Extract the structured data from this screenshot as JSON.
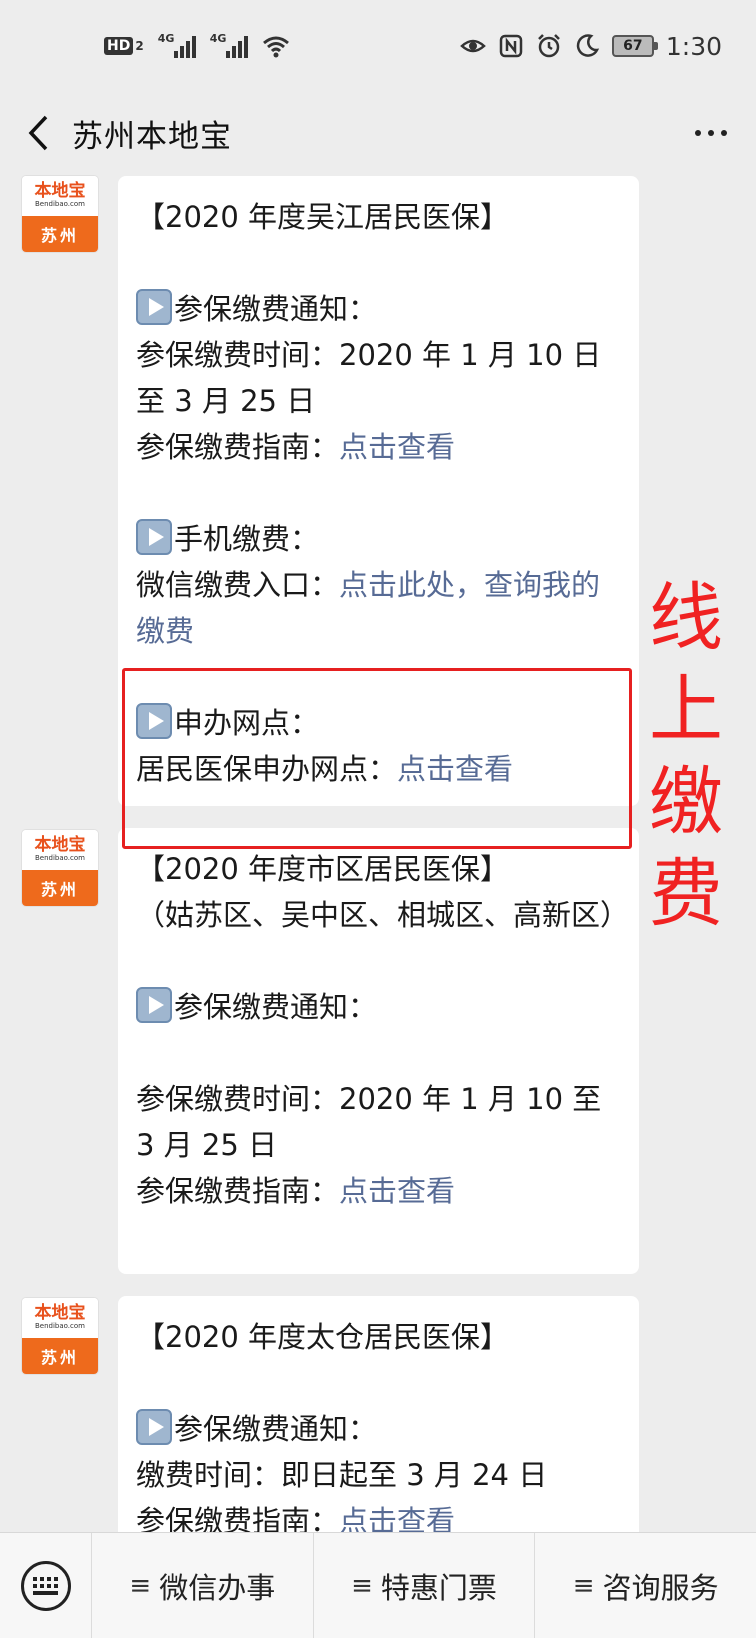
{
  "status_bar": {
    "hd": "HD",
    "hd_sub": "2",
    "sig1": "4G",
    "sig2": "4G",
    "battery": "67",
    "time": "1:30"
  },
  "nav": {
    "title": "苏州本地宝",
    "back_icon": "chevron-left-icon",
    "more_icon": "more-dots-icon"
  },
  "avatar": {
    "brand": "本地宝",
    "url": "Bendibao.com",
    "city": "苏州"
  },
  "messages": [
    {
      "title": "【2020 年度吴江居民医保】",
      "s1_head": "参保缴费通知：",
      "s1_time": "参保缴费时间：2020 年 1 月 10 日至 3 月 25 日",
      "s1_guide": "参保缴费指南：",
      "s1_guide_link": "点击查看",
      "s2_head": "手机缴费：",
      "s2_entry": "微信缴费入口：",
      "s2_entry_link": "点击此处，查询我的缴费",
      "s3_head": "申办网点：",
      "s3_points": "居民医保申办网点：",
      "s3_points_link": "点击查看"
    },
    {
      "title": "【2020 年度市区居民医保】",
      "subtitle": "（姑苏区、吴中区、相城区、高新区）",
      "s1_head": "参保缴费通知：",
      "s1_time": "参保缴费时间：2020 年 1 月 10 至 3 月 25 日",
      "s1_guide": "参保缴费指南：",
      "s1_guide_link": "点击查看"
    },
    {
      "title": "【2020 年度太仓居民医保】",
      "s1_head": "参保缴费通知：",
      "s1_time": "缴费时间：即日起至 3 月 24 日",
      "s1_guide": "参保缴费指南：",
      "s1_guide_link": "点击查看"
    }
  ],
  "annotation": {
    "label": "线上缴费",
    "color": "#f02222"
  },
  "bottom_menu": {
    "keyboard_icon": "keyboard-icon",
    "items": [
      {
        "label": "微信办事"
      },
      {
        "label": "特惠门票"
      },
      {
        "label": "咨询服务"
      }
    ]
  }
}
